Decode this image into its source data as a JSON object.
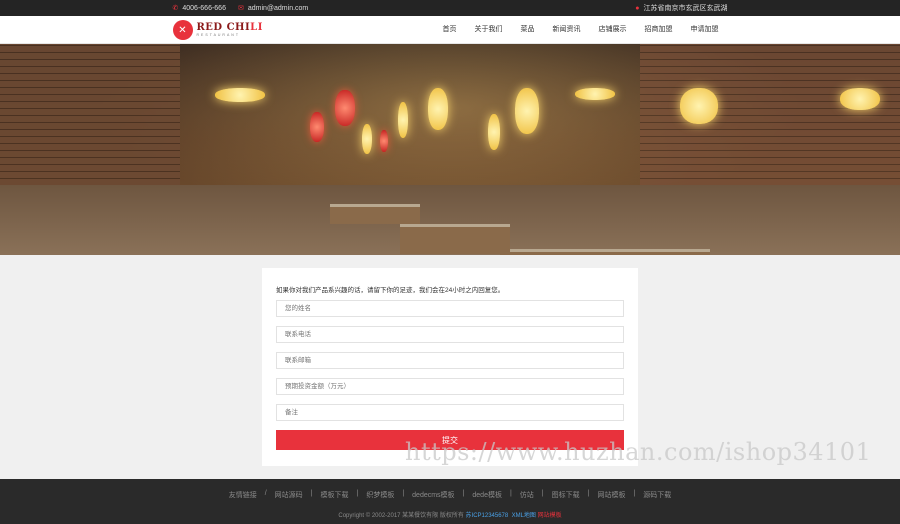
{
  "topbar": {
    "phone": "4006-666-666",
    "email": "admin@admin.com",
    "address": "江苏省南京市玄武区玄武湖"
  },
  "logo": {
    "name_main": "RED CHI",
    "name_accent": "LI",
    "subtitle": "RESTAURANT"
  },
  "nav": [
    {
      "label": "首页"
    },
    {
      "label": "关于我们"
    },
    {
      "label": "菜品"
    },
    {
      "label": "新闻资讯"
    },
    {
      "label": "店铺展示"
    },
    {
      "label": "招商加盟"
    },
    {
      "label": "申请加盟"
    }
  ],
  "form": {
    "intro": "如果你对我们产品系兴趣的话，请留下你的足迹，我们会在24小时之内回复您。",
    "fields": [
      {
        "placeholder": "您的姓名"
      },
      {
        "placeholder": "联系电话"
      },
      {
        "placeholder": "联系邮箱"
      },
      {
        "placeholder": "预期投资金额（万元）"
      },
      {
        "placeholder": "备注"
      }
    ],
    "submit": "提交"
  },
  "footer": {
    "links": [
      "友情链接",
      "/",
      "网站源码",
      "|",
      "模板下载",
      "|",
      "织梦模板",
      "|",
      "dedecms模板",
      "|",
      "dede模板",
      "|",
      "仿站",
      "|",
      "图标下载",
      "|",
      "网站模板",
      "|",
      "源码下载"
    ],
    "copyright": "Copyright © 2002-2017 某某餐饮有限 版权所有",
    "icp": "苏ICP12345678",
    "sitemap": "XML地图",
    "template": "网站模板"
  },
  "watermark": "https://www.huzhan.com/ishop34101",
  "colors": {
    "accent": "#e8323c",
    "dark": "#242424"
  }
}
